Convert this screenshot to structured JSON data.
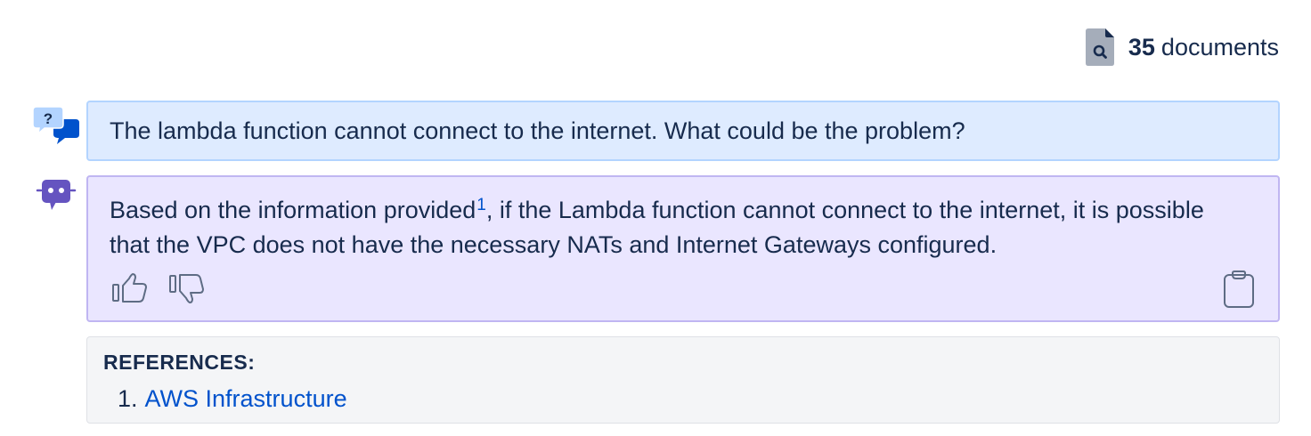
{
  "header": {
    "document_count": "35",
    "document_label": "documents",
    "icon": "document-search-icon"
  },
  "conversation": {
    "question": {
      "avatar_icon": "question-chat-icon",
      "text": "The lambda function cannot connect to the internet. What could be the problem?"
    },
    "answer": {
      "avatar_icon": "bot-icon",
      "text_before_citation": "Based on the information provided",
      "citation": "1",
      "text_after_citation": ", if the Lambda function cannot connect to the internet, it is possible that the VPC does not have the necessary NATs and Internet Gateways configured.",
      "actions": {
        "thumbs_up_icon": "thumbs-up-icon",
        "thumbs_down_icon": "thumbs-down-icon",
        "copy_icon": "clipboard-icon"
      }
    }
  },
  "references": {
    "title": "REFERENCES:",
    "items": [
      {
        "number": "1.",
        "label": "AWS Infrastructure"
      }
    ]
  },
  "colors": {
    "question_bg": "#deebff",
    "question_border": "#b3d4ff",
    "answer_bg": "#eae6ff",
    "answer_border": "#c0b6f2",
    "link": "#0052cc",
    "text": "#172b4d",
    "bot_purple": "#6554c0",
    "references_bg": "#f4f5f7"
  }
}
